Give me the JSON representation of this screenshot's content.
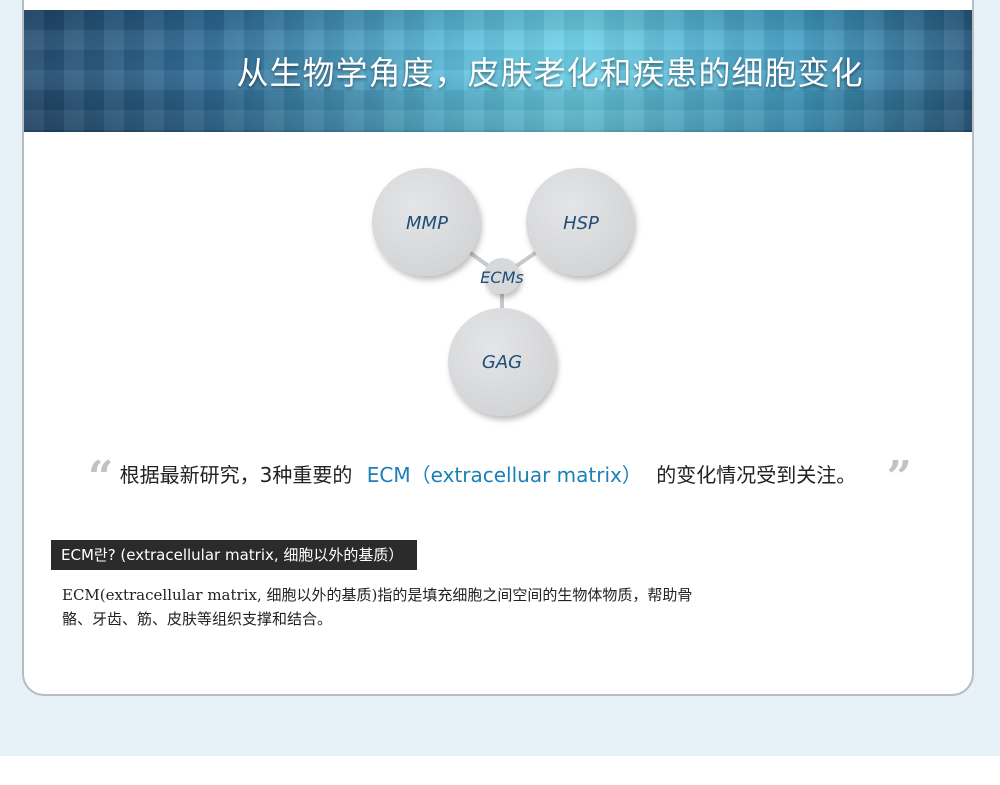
{
  "banner": {
    "title": "从生物学角度，皮肤老化和疾患的细胞变化"
  },
  "diagram": {
    "center_label": "ECMs",
    "nodes": [
      {
        "label": "MMP"
      },
      {
        "label": "HSP"
      },
      {
        "label": "GAG"
      }
    ]
  },
  "quote": {
    "open_mark": "“",
    "text_before": "根据最新研究，3种重要的",
    "highlight": "ECM（extracelluar matrix）",
    "text_after": "的变化情况受到关注。",
    "close_mark": "”"
  },
  "definition": {
    "label": "ECM란? (extracellular matrix, 细胞以外的基质）",
    "body": "ECM(extracellular matrix, 细胞以外的基质)指的是填充细胞之间空间的生物体物质，帮助骨骼、牙齿、筋、皮肤等组织支撑和结合。"
  },
  "colors": {
    "accent": "#1b7fb8",
    "node_label": "#1f4e79",
    "label_bg": "#2b2b2b"
  }
}
